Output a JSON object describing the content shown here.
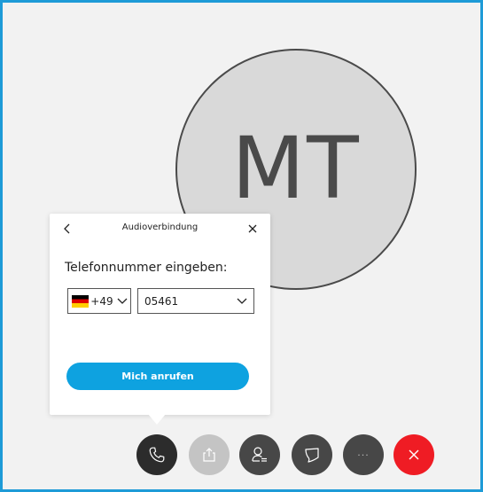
{
  "participant": {
    "initials": "MT"
  },
  "audio_popup": {
    "title": "Audioverbindung",
    "phone_label": "Telefonnummer eingeben:",
    "country_code": "+49",
    "phone_number": "05461",
    "call_button_label": "Mich anrufen",
    "accent_color": "#0ea2e0"
  },
  "toolbar": {
    "buttons": [
      {
        "icon": "phone-icon",
        "label": ""
      },
      {
        "icon": "share-icon",
        "label": ""
      },
      {
        "icon": "participants-icon",
        "label": ""
      },
      {
        "icon": "chat-icon",
        "label": ""
      },
      {
        "icon": "more-icon",
        "label": "···"
      },
      {
        "icon": "hangup-icon",
        "label": ""
      }
    ],
    "hangup_color": "#ef1c24"
  }
}
